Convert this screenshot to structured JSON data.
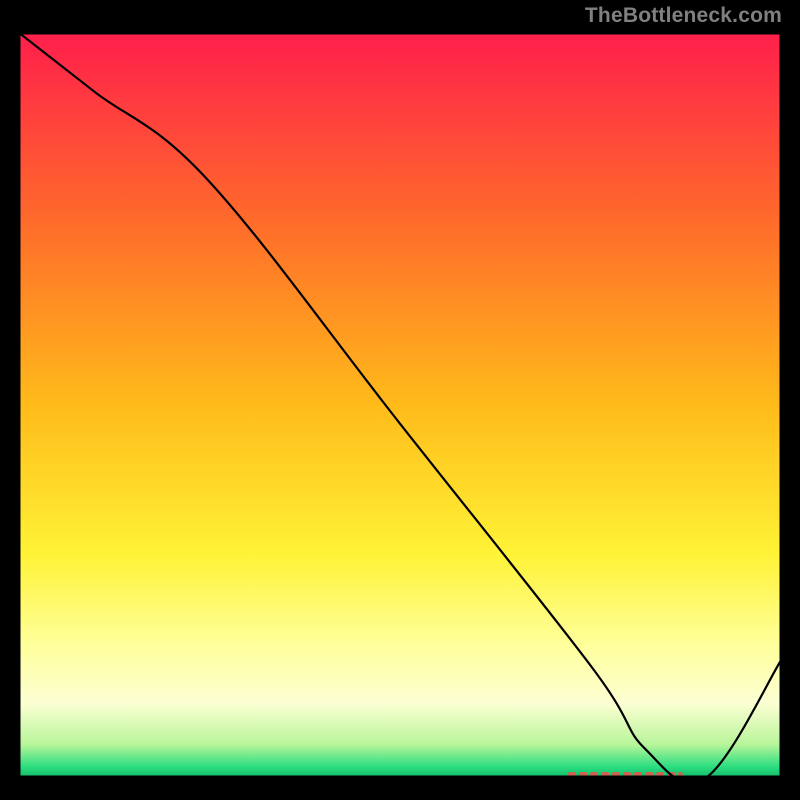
{
  "attribution": "TheBottleneck.com",
  "chart_data": {
    "type": "line",
    "title": "",
    "xlabel": "",
    "ylabel": "",
    "xlim": [
      0,
      100
    ],
    "ylim": [
      0,
      100
    ],
    "grid": false,
    "legend": null,
    "series": [
      {
        "name": "curve",
        "x": [
          0,
          10,
          25,
          50,
          75,
          82,
          90,
          100
        ],
        "values": [
          100,
          92,
          80,
          47.5,
          15,
          4,
          0,
          16
        ]
      }
    ],
    "marker": {
      "x_start": 72,
      "x_end": 87,
      "y": 0,
      "color": "#d06050",
      "label": ""
    },
    "background": {
      "type": "vertical-gradient",
      "stops": [
        {
          "pos": 0.0,
          "color": "#ff1e4c"
        },
        {
          "pos": 0.25,
          "color": "#ff6a2b"
        },
        {
          "pos": 0.5,
          "color": "#ffbb1a"
        },
        {
          "pos": 0.7,
          "color": "#fff336"
        },
        {
          "pos": 0.82,
          "color": "#ffff9a"
        },
        {
          "pos": 0.9,
          "color": "#fcffd3"
        },
        {
          "pos": 0.955,
          "color": "#b8f59a"
        },
        {
          "pos": 0.985,
          "color": "#2bde80"
        },
        {
          "pos": 1.0,
          "color": "#0fb867"
        }
      ]
    },
    "line_style": {
      "color": "#000000",
      "width": 2.2
    }
  },
  "frame": {
    "stroke": "#000000",
    "width": 5
  }
}
